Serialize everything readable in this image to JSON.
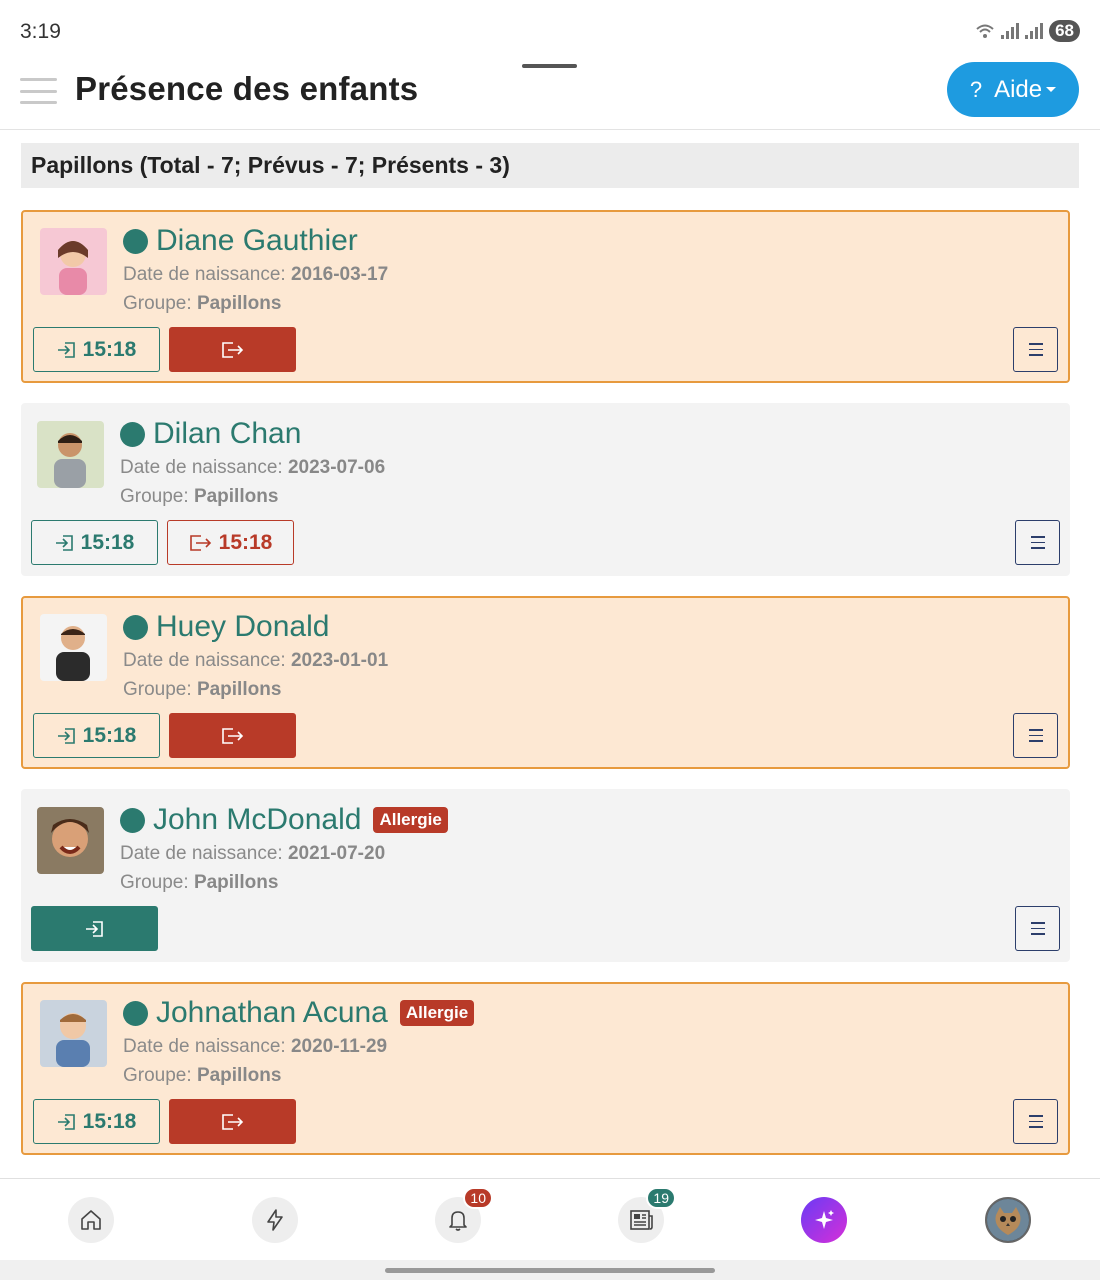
{
  "status_bar": {
    "time": "3:19",
    "battery": "68"
  },
  "header": {
    "title": "Présence des enfants",
    "help_label": "Aide",
    "help_icon": "?"
  },
  "group": {
    "title": "Papillons (Total - 7; Prévus - 7; Présents - 3)"
  },
  "labels": {
    "dob": "Date de naissance:",
    "group": "Groupe:",
    "allergy": "Allergie"
  },
  "children": [
    {
      "name": "Diane Gauthier",
      "dob": "2016-03-17",
      "group": "Papillons",
      "checkin": "15:18",
      "checkout": "",
      "present": true,
      "allergy": false
    },
    {
      "name": "Dilan Chan",
      "dob": "2023-07-06",
      "group": "Papillons",
      "checkin": "15:18",
      "checkout": "15:18",
      "present": false,
      "allergy": false
    },
    {
      "name": "Huey Donald",
      "dob": "2023-01-01",
      "group": "Papillons",
      "checkin": "15:18",
      "checkout": "",
      "present": true,
      "allergy": false
    },
    {
      "name": "John McDonald",
      "dob": "2021-07-20",
      "group": "Papillons",
      "checkin": "",
      "checkout": "",
      "present": false,
      "allergy": true
    },
    {
      "name": "Johnathan Acuna",
      "dob": "2020-11-29",
      "group": "Papillons",
      "checkin": "15:18",
      "checkout": "",
      "present": true,
      "allergy": true
    }
  ],
  "bottom_nav": {
    "items": [
      {
        "icon": "home-icon"
      },
      {
        "icon": "lightning-icon"
      },
      {
        "icon": "bell-icon",
        "badge": "10"
      },
      {
        "icon": "newspaper-icon",
        "badge": "19"
      },
      {
        "icon": "sparkles-icon"
      },
      {
        "icon": "profile-avatar"
      }
    ]
  },
  "colors": {
    "accent_teal": "#2b7a6f",
    "checkout_red": "#b83a28",
    "present_bg": "#fde8d3",
    "present_border": "#e79a3e",
    "help_blue": "#1e9be0"
  }
}
